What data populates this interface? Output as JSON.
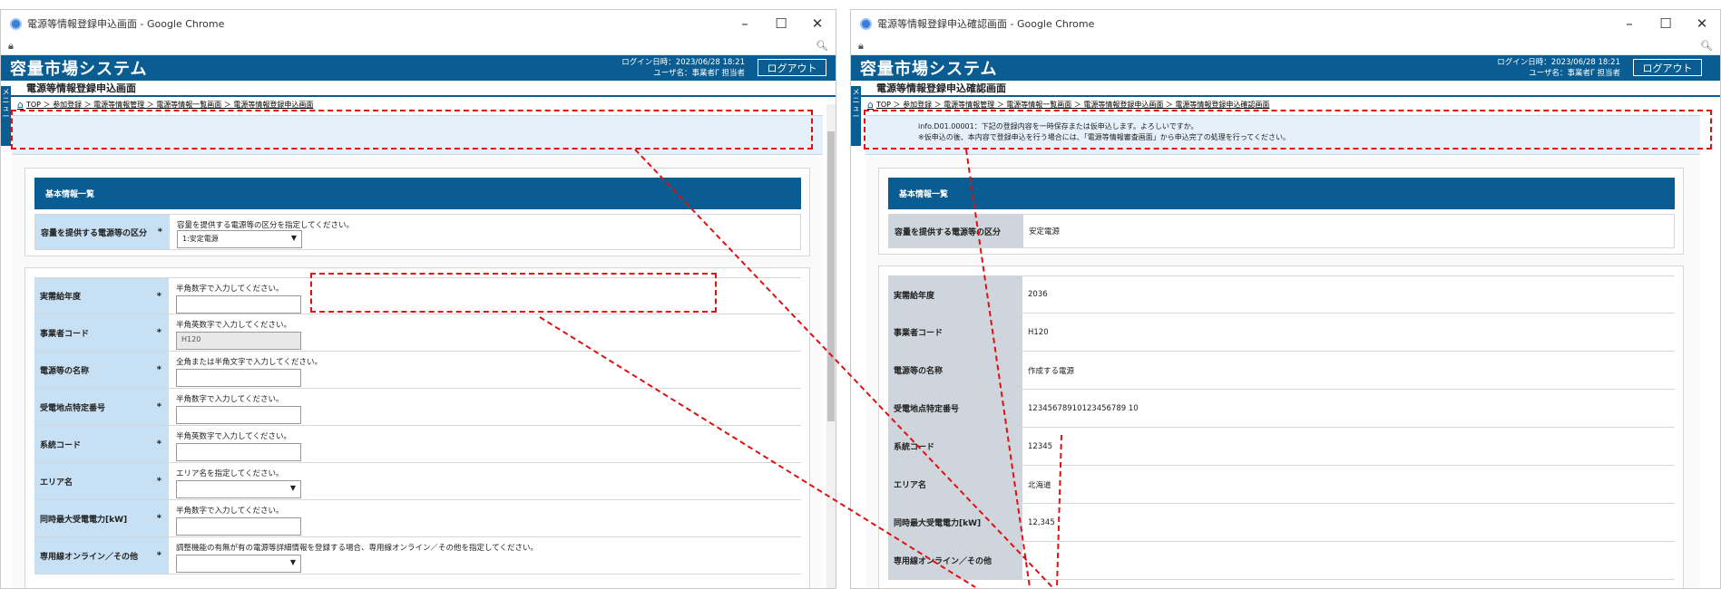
{
  "left": {
    "window_title": "電源等情報登録申込画面 - Google Chrome",
    "system_name": "容量市場システム",
    "login_time": "ログイン日時：2023/06/28 18:21",
    "user_name": "ユーザ名：事業者Γ 担当者",
    "logout_label": "ログアウト",
    "page_title": "電源等情報登録申込画面",
    "breadcrumb": "TOP ＞ 参加登録 ＞ 電源等情報管理 ＞ 電源等情報一覧画面 ＞ 電源等情報登録申込画面",
    "side_tab": "メニュー",
    "section1_title": "基本情報一覧",
    "kubun": {
      "label": "容量を提供する電源等の区分",
      "hint": "容量を提供する電源等の区分を指定してください。",
      "value": "1:安定電源"
    },
    "rows": [
      {
        "label": "実需給年度",
        "hint": "半角数字で入力してください。",
        "value": ""
      },
      {
        "label": "事業者コード",
        "hint": "半角英数字で入力してください。",
        "value": "H120"
      },
      {
        "label": "電源等の名称",
        "hint": "全角または半角文字で入力してください。",
        "value": ""
      },
      {
        "label": "受電地点特定番号",
        "hint": "半角数字で入力してください。",
        "value": ""
      },
      {
        "label": "系統コード",
        "hint": "半角英数字で入力してください。",
        "value": ""
      },
      {
        "label": "エリア名",
        "hint": "エリア名を指定してください。",
        "value": ""
      },
      {
        "label": "同時最大受電電力[kW]",
        "hint": "半角数字で入力してください。",
        "value": ""
      },
      {
        "label": "専用線オンライン／その他",
        "hint": "調整機能の有無が有の電源等詳細情報を登録する場合、専用線オンライン／その他を指定してください。",
        "value": ""
      }
    ],
    "required_mark": "*"
  },
  "right": {
    "window_title": "電源等情報登録申込確認画面 - Google Chrome",
    "system_name": "容量市場システム",
    "login_time": "ログイン日時：2023/06/28 18:21",
    "user_name": "ユーザ名：事業者Γ 担当者",
    "logout_label": "ログアウト",
    "page_title": "電源等情報登録申込確認画面",
    "breadcrumb": "TOP ＞ 参加登録 ＞ 電源等情報管理 ＞ 電源等情報一覧画面 ＞ 電源等情報登録申込画面 ＞ 電源等情報登録申込確認画面",
    "side_tab": "メニュー",
    "message_line1": "info.D01.00001：下記の登録内容を一時保存または仮申込します。よろしいですか。",
    "message_line2": "※仮申込の後、本内容で登録申込を行う場合には、「電源等情報審査画面」から申込完了の処理を行ってください。",
    "section1_title": "基本情報一覧",
    "kubun": {
      "label": "容量を提供する電源等の区分",
      "value": "安定電源"
    },
    "rows": [
      {
        "label": "実需給年度",
        "value": "2036"
      },
      {
        "label": "事業者コード",
        "value": "H120"
      },
      {
        "label": "電源等の名称",
        "value": "作成する電源"
      },
      {
        "label": "受電地点特定番号",
        "value": "12345678910123456789 10"
      },
      {
        "label": "系統コード",
        "value": "12345"
      },
      {
        "label": "エリア名",
        "value": "北海道"
      },
      {
        "label": "同時最大受電電力[kW]",
        "value": "12,345"
      },
      {
        "label": "専用線オンライン／その他",
        "value": ""
      }
    ]
  },
  "icons": {
    "chrome": "chrome-icon",
    "lock": "lock-icon",
    "zoom": "zoom-icon",
    "home": "home-icon"
  },
  "colors": {
    "header": "#0a5d92",
    "label_bg": "#c7e0f3",
    "confirm_label_bg": "#cfd5dc",
    "annotation": "#e01010"
  }
}
